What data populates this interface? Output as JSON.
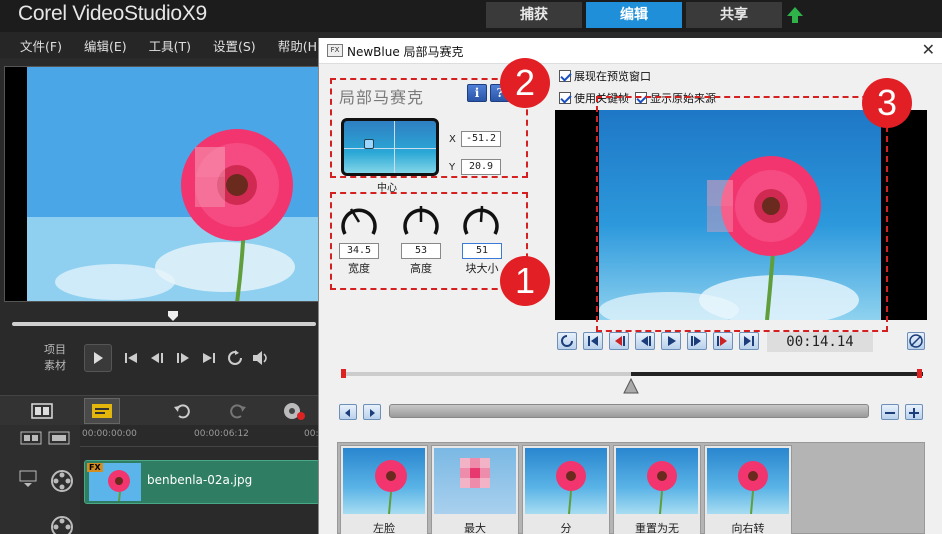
{
  "app": {
    "title": "Corel VideoStudioX9"
  },
  "tabs": [
    {
      "label": "捕获",
      "active": false
    },
    {
      "label": "编辑",
      "active": true
    },
    {
      "label": "共享",
      "active": false
    }
  ],
  "menu": [
    "文件(F)",
    "编辑(E)",
    "工具(T)",
    "设置(S)",
    "帮助(H)"
  ],
  "player": {
    "project_label": "项目",
    "clip_label": "素材"
  },
  "timeline": {
    "ruler": [
      "00:00:00:00",
      "00:00:06:12",
      "00:"
    ],
    "clip": {
      "fx": "FX",
      "name": "benbenla-02a.jpg"
    }
  },
  "dialog": {
    "icon_text": "FX",
    "title": "NewBlue 局部马赛克",
    "close": "✕",
    "panel_title": "局部马赛克",
    "info_label": "i",
    "help_label": "?",
    "center_label": "中心",
    "x_label": "X",
    "x_value": "-51.2",
    "y_label": "Y",
    "y_value": "20.9",
    "dials": [
      {
        "label": "宽度",
        "value": "34.5"
      },
      {
        "label": "高度",
        "value": "53"
      },
      {
        "label": "块大小",
        "value": "51"
      }
    ],
    "checkboxes": [
      {
        "label": "展现在预览窗口",
        "checked": true
      },
      {
        "label": "使用关键帧",
        "checked": true
      },
      {
        "label": "显示原始来源",
        "checked": true
      }
    ],
    "timecode": "00:14.14",
    "presets": [
      "左脸",
      "最大",
      "分",
      "重置为无",
      "向右转"
    ]
  },
  "annotations": [
    "1",
    "2",
    "3"
  ],
  "colors": {
    "accent": "#1e8fd8",
    "annotation": "#e21f24",
    "clip": "#2f7d62"
  }
}
